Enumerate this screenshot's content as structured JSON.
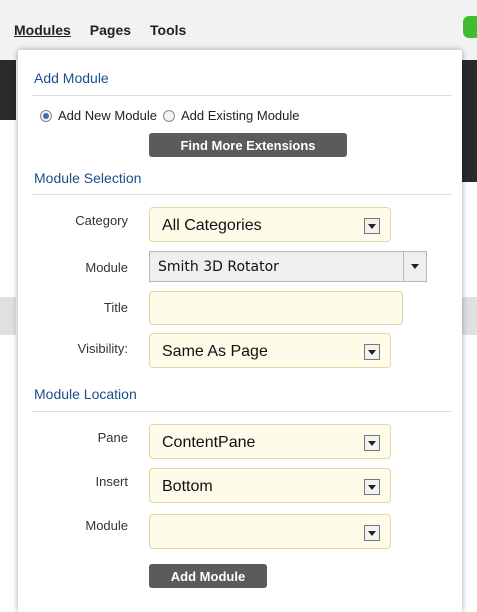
{
  "menu": {
    "items": [
      "Modules",
      "Pages",
      "Tools"
    ]
  },
  "add_module": {
    "title": "Add Module",
    "radio_new": "Add New Module",
    "radio_existing": "Add Existing Module",
    "find_more": "Find More Extensions"
  },
  "module_selection": {
    "title": "Module Selection",
    "category_label": "Category",
    "category_value": "All Categories",
    "module_label": "Module",
    "module_value": "Smith 3D Rotator",
    "title_label": "Title",
    "title_value": "",
    "visibility_label": "Visibility:",
    "visibility_value": "Same As Page"
  },
  "module_location": {
    "title": "Module Location",
    "pane_label": "Pane",
    "pane_value": "ContentPane",
    "insert_label": "Insert",
    "insert_value": "Bottom",
    "module_label": "Module",
    "module_value": ""
  },
  "actions": {
    "add_module": "Add Module"
  },
  "colors": {
    "section_title": "#1a4f8a",
    "field_bg": "#fefbe8",
    "button_bg": "#5b5b5b",
    "status_green": "#3fbf2f"
  }
}
